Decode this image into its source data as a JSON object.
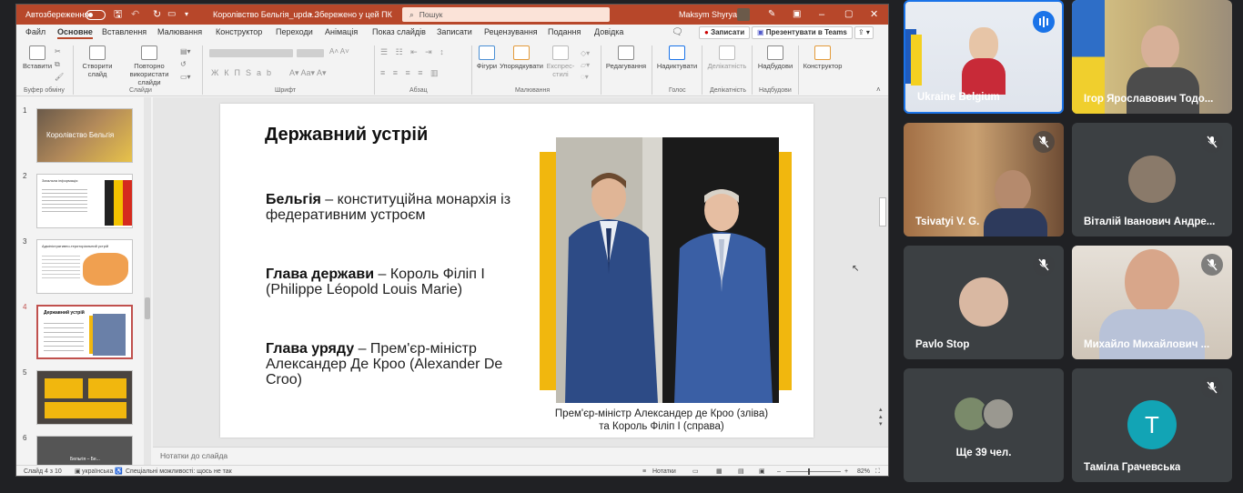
{
  "ppt": {
    "autosave_label": "Автозбереження",
    "doc_title": "Королівство Бельгія_upda...",
    "save_status": "• Збережено у цей ПК",
    "search_placeholder": "Пошук",
    "user": "Maksym Shyryaev",
    "tabs": [
      "Файл",
      "Основне",
      "Вставлення",
      "Малювання",
      "Конструктор",
      "Переходи",
      "Анімація",
      "Показ слайдів",
      "Записати",
      "Рецензування",
      "Подання",
      "Довідка"
    ],
    "active_tab": "Основне",
    "record_btn": "Записати",
    "present_btn": "Презентувати в Teams",
    "ribbon": {
      "paste": "Вставити",
      "new_slide": "Створити слайд",
      "reuse_slides": "Повторно використати слайди",
      "shapes": "Фігури",
      "arrange": "Упорядкувати",
      "quick_styles": "Експрес-стилі",
      "editing": "Редагування",
      "dictate": "Надиктувати",
      "sensitivity": "Делікатність",
      "addins": "Надбудови",
      "designer": "Конструктор",
      "groups": {
        "clipboard": "Буфер обміну",
        "slides": "Слайди",
        "font": "Шрифт",
        "paragraph": "Абзац",
        "drawing": "Малювання",
        "voice": "Голос",
        "sensitivity": "Делікатність",
        "addins": "Надбудови"
      }
    },
    "thumbnails": [
      {
        "num": "1",
        "title": "Королівство Бельгія"
      },
      {
        "num": "2",
        "title": "Загальна інформація"
      },
      {
        "num": "3",
        "title": "Адміністративно-територіальний устрій"
      },
      {
        "num": "4",
        "title": "Державний устрій"
      },
      {
        "num": "5",
        "title": ""
      },
      {
        "num": "6",
        "title": "Бельгія – Бе..."
      }
    ],
    "slide": {
      "title": "Державний устрій",
      "p1_bold": "Бельгія",
      "p1_text": " – конституційна монархія із федеративним устроєм",
      "p2_bold": "Глава держави",
      "p2_text": " – Король Філіп I (Philippe Léopold Louis Marie)",
      "p3_bold": "Глава уряду",
      "p3_text": " – Прем'єр-міністр Александер Де Кроо (Alexander De Croo)",
      "caption_line1": "Прем'єр-міністр Александер де Кроо (зліва)",
      "caption_line2": "та Король Філіп I (справа)"
    },
    "notes_placeholder": "Нотатки до слайда",
    "status": {
      "slide_counter": "Слайд 4 з 10",
      "language": "українська",
      "accessibility": "Спеціальні можливості: щось не так",
      "notes": "Нотатки",
      "zoom": "82%"
    }
  },
  "participants": [
    {
      "name": "Ukraine Belgium",
      "speaking": true
    },
    {
      "name": "Ігор Ярославович Тодо..."
    },
    {
      "name": "Tsivatyi V. G."
    },
    {
      "name": "Віталій Іванович Андре..."
    },
    {
      "name": "Pavlo Stop"
    },
    {
      "name": "Михайло Михайлович ..."
    },
    {
      "name": "Ще 39 чел."
    },
    {
      "name": "Таміла Грачевська",
      "initial": "Т",
      "avatar_color": "#12a4b5"
    }
  ],
  "colors": {
    "accent": "#b7472a",
    "slide_frame": "#f1b70e",
    "speaking": "#1a73e8"
  }
}
